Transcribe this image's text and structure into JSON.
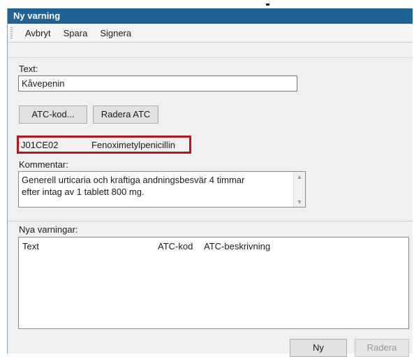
{
  "window": {
    "title": "Ny varning"
  },
  "toolbar": {
    "items": [
      "Avbryt",
      "Spara",
      "Signera"
    ]
  },
  "text_field": {
    "label": "Text:",
    "value": "Kåvepenin"
  },
  "atc": {
    "atc_button": "ATC-kod...",
    "delete_button": "Radera ATC",
    "code": "J01CE02",
    "description": "Fenoximetylpenicillin"
  },
  "comment": {
    "label": "Kommentar:",
    "value": "Generell urticaria och kraftiga andningsbesvär 4 timmar\nefter intag av 1 tablett 800 mg."
  },
  "new_warnings": {
    "label": "Nya varningar:",
    "columns": [
      "Text",
      "ATC-kod",
      "ATC-beskrivning"
    ],
    "rows": []
  },
  "footer": {
    "new_button": "Ny",
    "delete_button": "Radera"
  },
  "colors": {
    "titlebar": "#1f6395",
    "highlight_border": "#b3151b"
  }
}
